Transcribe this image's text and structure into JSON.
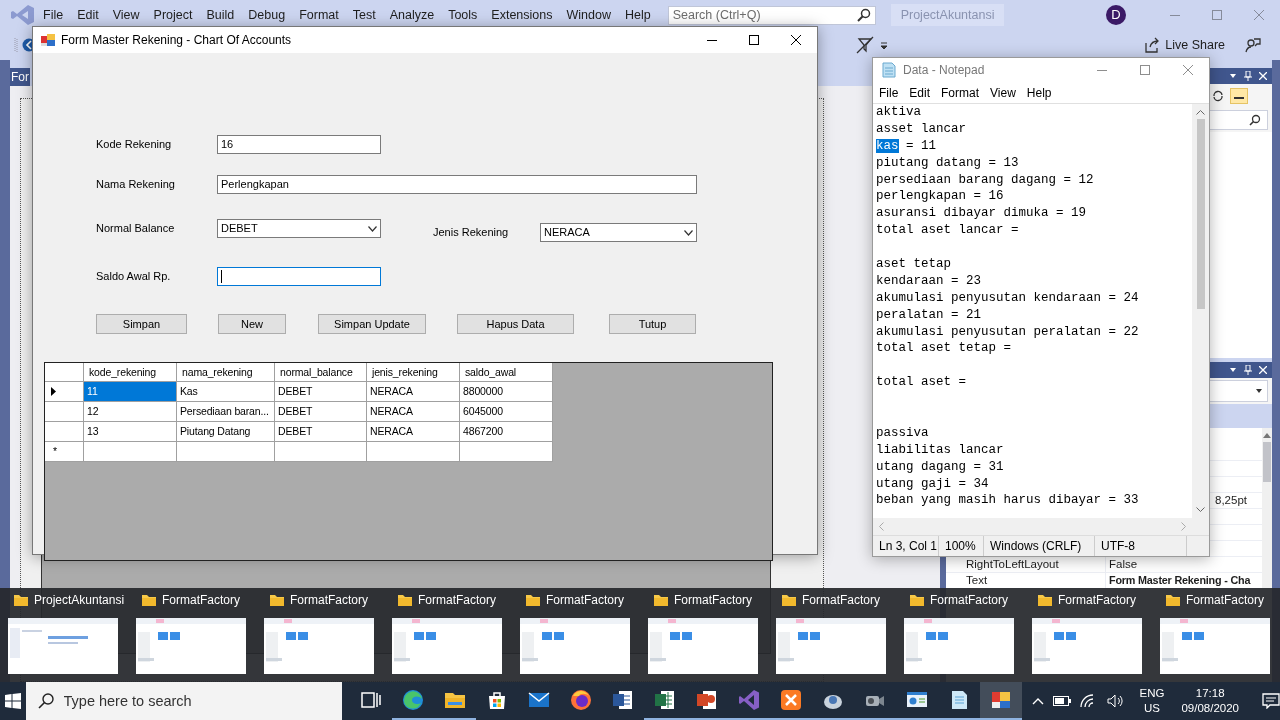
{
  "ide": {
    "menu": [
      "File",
      "Edit",
      "View",
      "Project",
      "Build",
      "Debug",
      "Format",
      "Test",
      "Analyze",
      "Tools",
      "Extensions",
      "Window",
      "Help"
    ],
    "search": {
      "placeholder": "Search (Ctrl+Q)"
    },
    "solution_name": "ProjectAkuntansi",
    "account_initial": "D",
    "live_share": "Live Share",
    "document_tab": "For",
    "properties": [
      {
        "kind": "blank"
      },
      {
        "kind": "blank"
      },
      {
        "kind": "blank"
      },
      {
        "kind": "tail",
        "value": "8,25pt"
      },
      {
        "kind": "blank"
      },
      {
        "kind": "blank"
      },
      {
        "kind": "blank"
      },
      {
        "kind": "pair",
        "name": "RightToLeftLayout",
        "value": "False",
        "modified": false
      },
      {
        "kind": "pair",
        "name": "Text",
        "value": "Form Master Rekening - Cha",
        "modified": true
      }
    ]
  },
  "form_window": {
    "title": "Form Master Rekening - Chart Of Accounts",
    "field_rows": [
      {
        "fields": [
          {
            "kind": "text",
            "label": "Kode Rekening",
            "value": "16",
            "focused": false
          }
        ]
      },
      {
        "fields": [
          {
            "kind": "text",
            "label": "Nama Rekening",
            "value": "Perlengkapan",
            "focused": false
          }
        ]
      },
      {
        "fields": [
          {
            "kind": "combo",
            "label": "Normal Balance",
            "value": "DEBET"
          },
          {
            "kind": "combo",
            "label": "Jenis Rekening",
            "value": "NERACA"
          }
        ]
      },
      {
        "fields": [
          {
            "kind": "text",
            "label": "Saldo Awal Rp.",
            "focused": true
          }
        ]
      }
    ],
    "buttons": [
      "Simpan",
      "New",
      "Simpan Update",
      "Hapus Data",
      "Tutup"
    ],
    "grid": {
      "columns": [
        "kode_rekening",
        "nama_rekening",
        "normal_balance",
        "jenis_rekening",
        "saldo_awal"
      ],
      "rows": [
        {
          "current": true,
          "cells": [
            {
              "text": "11",
              "selected": true
            },
            {
              "text": "Kas",
              "selected": false
            },
            {
              "text": "DEBET",
              "selected": false
            },
            {
              "text": "NERACA",
              "selected": false
            },
            {
              "text": "8800000",
              "selected": false
            }
          ]
        },
        {
          "current": false,
          "cells": [
            {
              "text": "12",
              "selected": false
            },
            {
              "text": "Persediaan baran...",
              "selected": false
            },
            {
              "text": "DEBET",
              "selected": false
            },
            {
              "text": "NERACA",
              "selected": false
            },
            {
              "text": "6045000",
              "selected": false
            }
          ]
        },
        {
          "current": false,
          "cells": [
            {
              "text": "13",
              "selected": false
            },
            {
              "text": "Piutang Datang",
              "selected": false
            },
            {
              "text": "DEBET",
              "selected": false
            },
            {
              "text": "NERACA",
              "selected": false
            },
            {
              "text": "4867200",
              "selected": false
            }
          ]
        }
      ],
      "new_row_marker": "*"
    }
  },
  "notepad": {
    "title": "Data - Notepad",
    "menu": [
      "File",
      "Edit",
      "Format",
      "View",
      "Help"
    ],
    "lines": [
      {
        "kind": "text",
        "text": "aktiva"
      },
      {
        "kind": "text",
        "text": "asset lancar"
      },
      {
        "kind": "text",
        "selection": "kas",
        "text": " = 11"
      },
      {
        "kind": "text",
        "text": "piutang datang = 13"
      },
      {
        "kind": "text",
        "text": "persediaan barang dagang = 12"
      },
      {
        "kind": "text",
        "text": "perlengkapan = 16"
      },
      {
        "kind": "text",
        "text": "asuransi dibayar dimuka = 19"
      },
      {
        "kind": "text",
        "text": "total aset lancar ="
      },
      {
        "kind": "blank"
      },
      {
        "kind": "text",
        "text": "aset tetap"
      },
      {
        "kind": "text",
        "text": "kendaraan = 23"
      },
      {
        "kind": "text",
        "text": "akumulasi penyusutan kendaraan = 24"
      },
      {
        "kind": "text",
        "text": "peralatan = 21"
      },
      {
        "kind": "text",
        "text": "akumulasi penyusutan peralatan = 22"
      },
      {
        "kind": "text",
        "text": "total aset tetap ="
      },
      {
        "kind": "blank"
      },
      {
        "kind": "text",
        "text": "total aset ="
      },
      {
        "kind": "blank"
      },
      {
        "kind": "blank"
      },
      {
        "kind": "text",
        "text": "passiva"
      },
      {
        "kind": "text",
        "text": "liabilitas lancar"
      },
      {
        "kind": "text",
        "text": "utang dagang = 31"
      },
      {
        "kind": "text",
        "text": "utang gaji = 34"
      },
      {
        "kind": "text",
        "text": "beban yang masih harus dibayar = 33"
      }
    ],
    "status": [
      "Ln 3, Col 1",
      "100%",
      "Windows (CRLF)",
      "UTF-8"
    ]
  },
  "switcher": [
    {
      "kind": "ide",
      "label": "ProjectAkuntansi"
    },
    {
      "kind": "folder",
      "label": "FormatFactory"
    },
    {
      "kind": "folder",
      "label": "FormatFactory"
    },
    {
      "kind": "folder",
      "label": "FormatFactory"
    },
    {
      "kind": "folder",
      "label": "FormatFactory"
    },
    {
      "kind": "folder",
      "label": "FormatFactory"
    },
    {
      "kind": "folder",
      "label": "FormatFactory"
    },
    {
      "kind": "folder",
      "label": "FormatFactory"
    },
    {
      "kind": "folder",
      "label": "FormatFactory"
    },
    {
      "kind": "folder",
      "label": "FormatFactory"
    }
  ],
  "taskbar": {
    "search": {
      "placeholder": "Type here to search"
    },
    "apps": [
      {
        "kind": "task-view",
        "running": false,
        "active": false
      },
      {
        "kind": "edge",
        "running": true,
        "active": false
      },
      {
        "kind": "explorer",
        "running": true,
        "active": false
      },
      {
        "kind": "store",
        "running": false,
        "active": false
      },
      {
        "kind": "mail",
        "running": false,
        "active": false
      },
      {
        "kind": "firefox",
        "running": false,
        "active": false
      },
      {
        "kind": "word",
        "running": false,
        "active": false
      },
      {
        "kind": "excel",
        "running": true,
        "active": false
      },
      {
        "kind": "powerpoint",
        "running": true,
        "active": false
      },
      {
        "kind": "visual-studio",
        "running": true,
        "active": false
      },
      {
        "kind": "xampp",
        "running": true,
        "active": false
      },
      {
        "kind": "scanner",
        "running": true,
        "active": false
      },
      {
        "kind": "camcorder",
        "running": true,
        "active": false
      },
      {
        "kind": "monitor",
        "running": true,
        "active": false
      },
      {
        "kind": "notepad",
        "running": true,
        "active": false
      },
      {
        "kind": "form-app",
        "running": true,
        "active": true
      }
    ],
    "language": "ENG",
    "region": "US",
    "time": "17:18",
    "date": "09/08/2020"
  }
}
